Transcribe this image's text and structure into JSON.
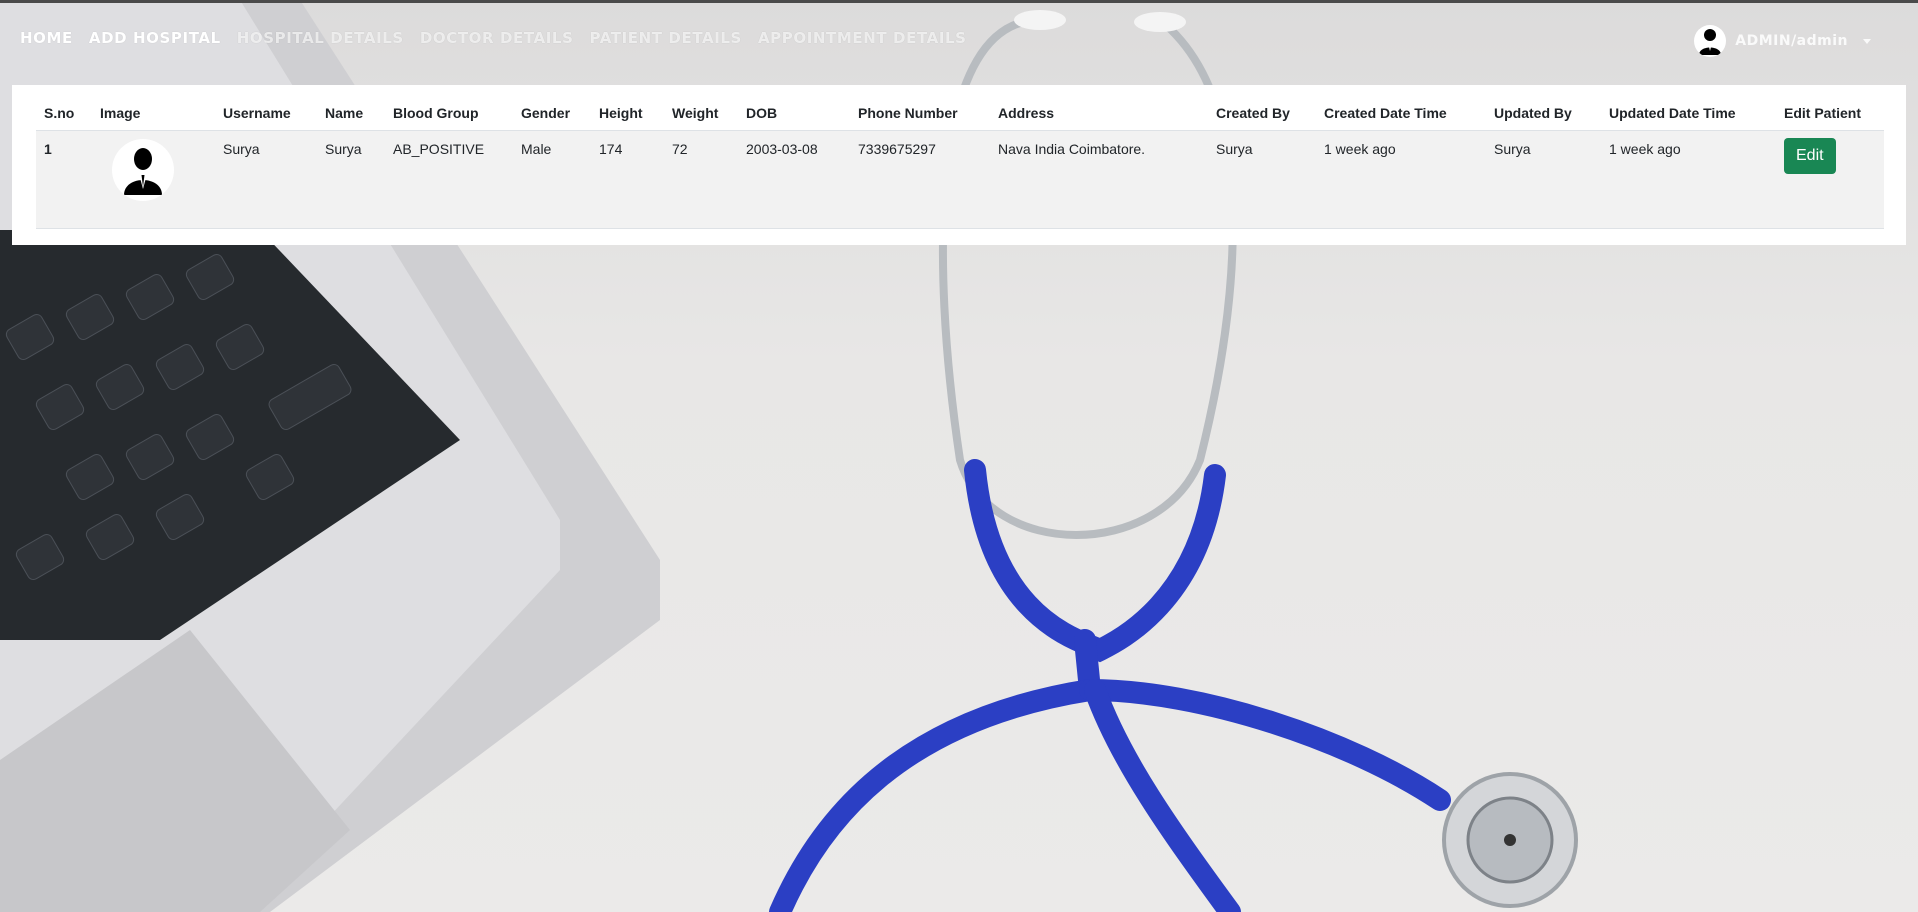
{
  "nav": {
    "links": [
      {
        "label": "HOME"
      },
      {
        "label": "ADD HOSPITAL"
      },
      {
        "label": "HOSPITAL DETAILS"
      },
      {
        "label": "DOCTOR DETAILS"
      },
      {
        "label": "PATIENT DETAILS"
      },
      {
        "label": "APPOINTMENT DETAILS"
      }
    ],
    "user": {
      "name": "ADMIN/admin",
      "icon": "user-avatar-icon"
    }
  },
  "table": {
    "headers": [
      "S.no",
      "Image",
      "Username",
      "Name",
      "Blood Group",
      "Gender",
      "Height",
      "Weight",
      "DOB",
      "Phone Number",
      "Address",
      "Created By",
      "Created Date Time",
      "Updated By",
      "Updated Date Time",
      "Edit Patient"
    ],
    "rows": [
      {
        "sno": "1",
        "image_icon": "patient-avatar-icon",
        "username": "Surya",
        "name": "Surya",
        "blood_group": "AB_POSITIVE",
        "gender": "Male",
        "height": "174",
        "weight": "72",
        "dob": "2003-03-08",
        "phone": "7339675297",
        "address": "Nava India Coimbatore.",
        "created_by": "Surya",
        "created_time": "1 week ago",
        "updated_by": "Surya",
        "updated_time": "1 week ago",
        "edit_label": "Edit"
      }
    ]
  },
  "colors": {
    "edit_button": "#198754",
    "panel": "#ffffff",
    "row_bg": "#f2f2f2"
  }
}
